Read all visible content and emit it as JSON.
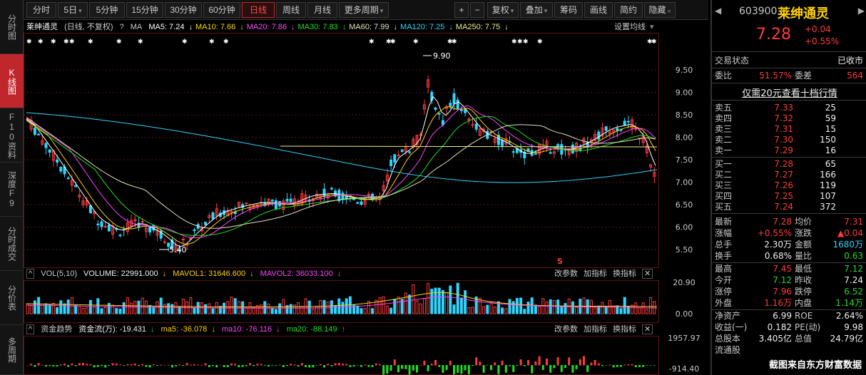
{
  "leftnav": [
    {
      "label": "分时图",
      "active": false
    },
    {
      "label": "K线图",
      "active": true
    },
    {
      "label": "F10资料",
      "active": false
    },
    {
      "label": "深度F9",
      "active": false
    },
    {
      "label": "分时成交",
      "active": false
    },
    {
      "label": "分价表",
      "active": false
    },
    {
      "label": "多周期",
      "active": false
    }
  ],
  "toolbar": {
    "periods": [
      "分时",
      "5日",
      "5分钟",
      "15分钟",
      "30分钟",
      "60分钟",
      "日线",
      "周线",
      "月线",
      "更多周期"
    ],
    "active_period": "日线",
    "plus": "+",
    "minus": "−",
    "tools": [
      "复权",
      "叠加",
      "筹码",
      "画线",
      "简约",
      "隐藏"
    ]
  },
  "main_header": {
    "stock_name": "莱绅通灵",
    "mode": "(日线, 不复权)",
    "ma": [
      {
        "text": "MA5: 7.24",
        "color": "#ffffff",
        "arrow": "↓"
      },
      {
        "text": "MA10: 7.66",
        "color": "#ffd200",
        "arrow": "↓"
      },
      {
        "text": "MA20: 7.86",
        "color": "#ff44ff",
        "arrow": "↓"
      },
      {
        "text": "MA30: 7.83",
        "color": "#22dd22",
        "arrow": "↓"
      },
      {
        "text": "MA60: 7.99",
        "color": "#e0e0c0",
        "arrow": "↓"
      },
      {
        "text": "MA120: 7.25",
        "color": "#2fd5ff",
        "arrow": "↓"
      },
      {
        "text": "MA250: 7.75",
        "color": "#eeee88",
        "arrow": "↓"
      }
    ],
    "settings": "设置均线",
    "prefix": "MA"
  },
  "price_axis": [
    "9.50",
    "9.00",
    "8.50",
    "8.00",
    "7.50",
    "7.00",
    "6.50",
    "6.00",
    "5.50"
  ],
  "annotations": {
    "high": "9.90",
    "low": "5.40",
    "marker": "S"
  },
  "vol_header": {
    "label": "VOL(5,10)",
    "volume": "VOLUME: 22991.000",
    "mavol1": "MAVOL1: 31646.600",
    "mavol2": "MAVOL2: 36033.100",
    "buttons": [
      "改参数",
      "加指标",
      "换指标"
    ]
  },
  "vol_axis": [
    "20.90",
    "0.00"
  ],
  "flow_header": {
    "label": "资金趋势",
    "flow": "资金流(万): -19.431",
    "ma5": "ma5: -36.078",
    "ma10": "ma10: -76.116",
    "ma20": "ma20: -88.149",
    "buttons": [
      "改参数",
      "加指标",
      "换指标"
    ]
  },
  "flow_axis": [
    "1957.97",
    "-914.40"
  ],
  "quote": {
    "code": "603900",
    "name": "莱绅通灵",
    "price": "7.28",
    "change": "+0.04",
    "change_pct": "+0.55%",
    "status_label": "交易状态",
    "status_value": "已收市",
    "webi_label": "委比",
    "webi_value": "51.57%",
    "wecha_label": "委差",
    "wecha_value": "564",
    "promo": "仅需20元查看十档行情",
    "asks": [
      {
        "label": "卖五",
        "price": "7.33",
        "vol": "25"
      },
      {
        "label": "卖四",
        "price": "7.32",
        "vol": "59"
      },
      {
        "label": "卖三",
        "price": "7.31",
        "vol": "15"
      },
      {
        "label": "卖二",
        "price": "7.30",
        "vol": "150"
      },
      {
        "label": "卖一",
        "price": "7.29",
        "vol": "16"
      }
    ],
    "bids": [
      {
        "label": "买一",
        "price": "7.28",
        "vol": "65"
      },
      {
        "label": "买二",
        "price": "7.27",
        "vol": "166"
      },
      {
        "label": "买三",
        "price": "7.26",
        "vol": "119"
      },
      {
        "label": "买四",
        "price": "7.25",
        "vol": "107"
      },
      {
        "label": "买五",
        "price": "7.24",
        "vol": "372"
      }
    ],
    "stats": [
      {
        "l1": "最新",
        "v1": "7.28",
        "c1": "red",
        "l2": "均价",
        "v2": "7.31",
        "c2": "red"
      },
      {
        "l1": "涨幅",
        "v1": "+0.55%",
        "c1": "red",
        "l2": "涨跌",
        "v2": "▲0.04",
        "c2": "red"
      },
      {
        "l1": "总手",
        "v1": "2.30万",
        "c1": "white",
        "l2": "金额",
        "v2": "1680万",
        "c2": "cyan"
      },
      {
        "l1": "换手",
        "v1": "0.68%",
        "c1": "white",
        "l2": "量比",
        "v2": "0.63",
        "c2": "green"
      },
      {
        "l1": "最高",
        "v1": "7.45",
        "c1": "red",
        "l2": "最低",
        "v2": "7.12",
        "c2": "green"
      },
      {
        "l1": "今开",
        "v1": "7.12",
        "c1": "green",
        "l2": "昨收",
        "v2": "7.24",
        "c2": "white"
      },
      {
        "l1": "涨停",
        "v1": "7.96",
        "c1": "red",
        "l2": "跌停",
        "v2": "6.52",
        "c2": "green"
      },
      {
        "l1": "外盘",
        "v1": "1.16万",
        "c1": "red",
        "l2": "内盘",
        "v2": "1.14万",
        "c2": "green"
      },
      {
        "l1": "净资产",
        "v1": "6.99",
        "c1": "white",
        "l2": "ROE",
        "v2": "2.64%",
        "c2": "white"
      },
      {
        "l1": "收益(一)",
        "v1": "0.182",
        "c1": "white",
        "l2": "PE(动)",
        "v2": "9.98",
        "c2": "white"
      },
      {
        "l1": "总股本",
        "v1": "3.405亿",
        "c1": "white",
        "l2": "总值",
        "v2": "24.79亿",
        "c2": "white"
      },
      {
        "l1": "流通股",
        "v1": "",
        "c1": "white",
        "l2": "",
        "v2": "",
        "c2": "white"
      }
    ]
  },
  "watermark": "截图来自东方财富数据",
  "colors": {
    "up": "#ff3b3b",
    "down": "#2fd5ff",
    "accent": "#c0272d",
    "grid": "#5a1414"
  }
}
